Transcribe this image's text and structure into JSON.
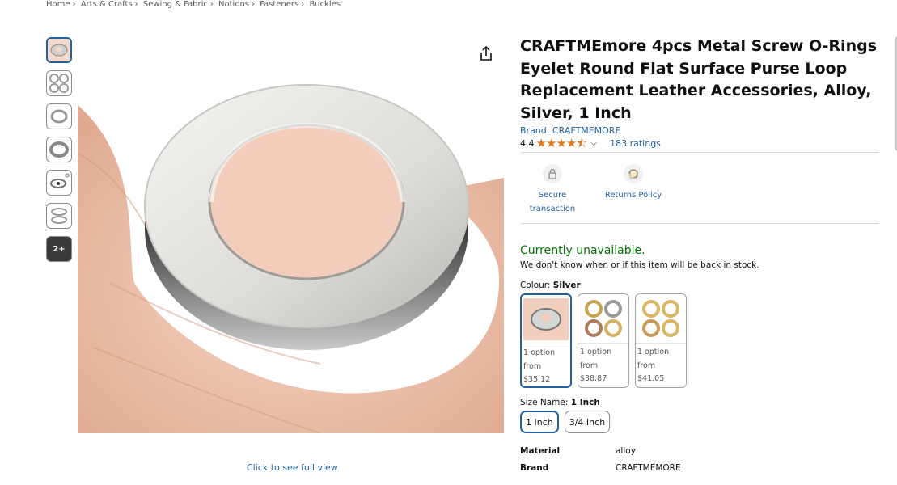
{
  "breadcrumb": [
    "Home",
    "Arts & Crafts",
    "Sewing & Fabric",
    "Notions",
    "Fasteners",
    "Buckles"
  ],
  "gallery": {
    "more_label": "2+",
    "full_view_label": "Click to see full view"
  },
  "product": {
    "title": "CRAFTMEmore 4pcs Metal Screw O-Rings Eyelet Round Flat Surface Purse Loop Replacement Leather Accessories, Alloy, Silver, 1 Inch",
    "brand": "Brand: CRAFTMEMORE",
    "rating_value": "4.4",
    "ratings_count": "183 ratings",
    "features": [
      {
        "label": "Secure transaction",
        "icon": "lock-icon"
      },
      {
        "label": "Returns Policy",
        "icon": "returns-icon"
      }
    ],
    "availability": "Currently unavailable.",
    "availability_note": "We don't know when or if this item will be back in stock.",
    "colour_label": "Colour: ",
    "colour_value": "Silver",
    "colours": [
      {
        "line1": "1 option",
        "line2": "from",
        "price": "$35.12"
      },
      {
        "line1": "1 option",
        "line2": "from",
        "price": "$38.87"
      },
      {
        "line1": "1 option",
        "line2": "from",
        "price": "$41.05"
      }
    ],
    "size_label": "Size Name: ",
    "size_value": "1 Inch",
    "sizes": [
      "1 Inch",
      "3/4 Inch"
    ],
    "specs": [
      {
        "key": "Material",
        "value": "alloy"
      },
      {
        "key": "Brand",
        "value": "CRAFTMEMORE"
      }
    ]
  },
  "colors": {
    "link": "#2162a1",
    "star": "#de7921",
    "available": "#007600"
  }
}
